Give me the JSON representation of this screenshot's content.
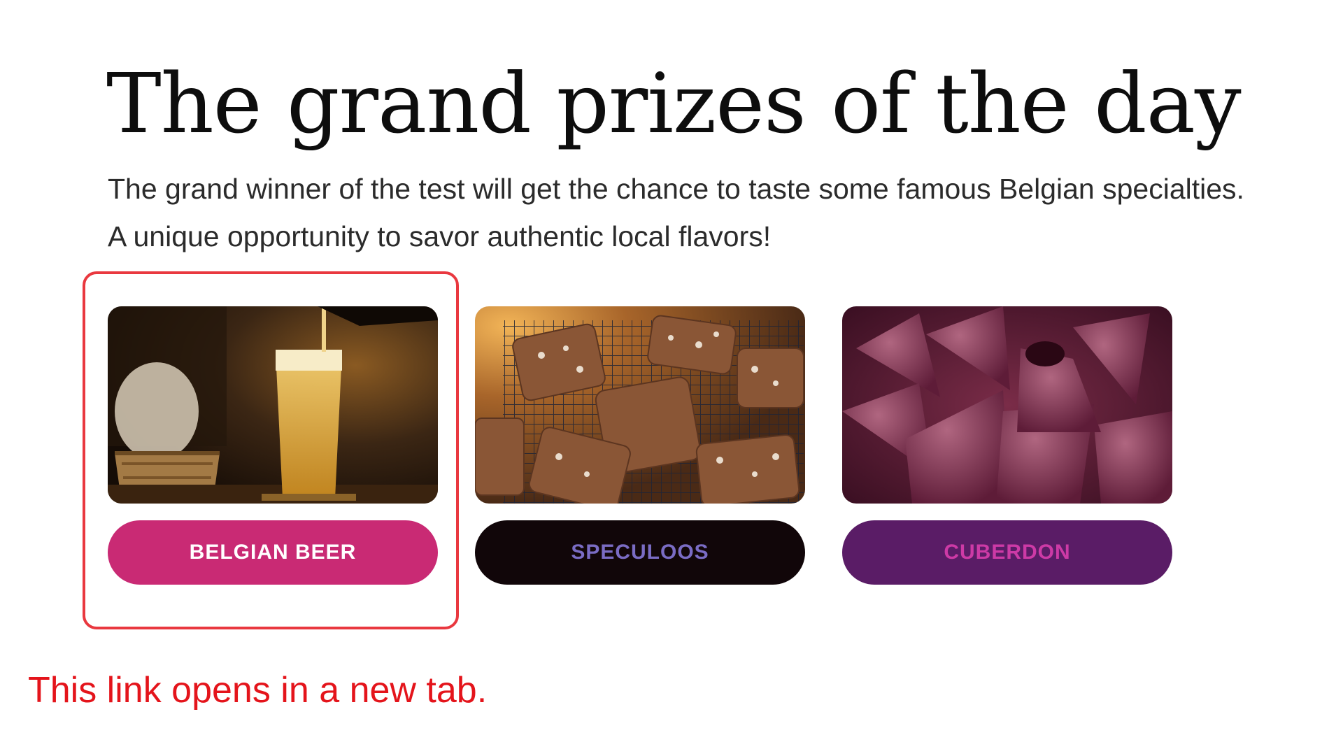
{
  "heading": "The grand prizes of the day",
  "intro": {
    "line1": "The grand winner of the test will get the chance to taste some famous Belgian specialties.",
    "line2": "A unique opportunity to savor authentic local flavors!"
  },
  "prizes": [
    {
      "label": "BELGIAN BEER",
      "image": "beer-photo",
      "button_color": "#c92a74",
      "text_color": "#ffffff"
    },
    {
      "label": "SPECULOOS",
      "image": "speculoos-photo",
      "button_color": "#110609",
      "text_color": "#7a6cc4"
    },
    {
      "label": "CUBERDON",
      "image": "cuberdon-photo",
      "button_color": "#5a1c66",
      "text_color": "#cd3aa6"
    }
  ],
  "focus_color": "#e9383f",
  "note": "This link opens in a new tab."
}
